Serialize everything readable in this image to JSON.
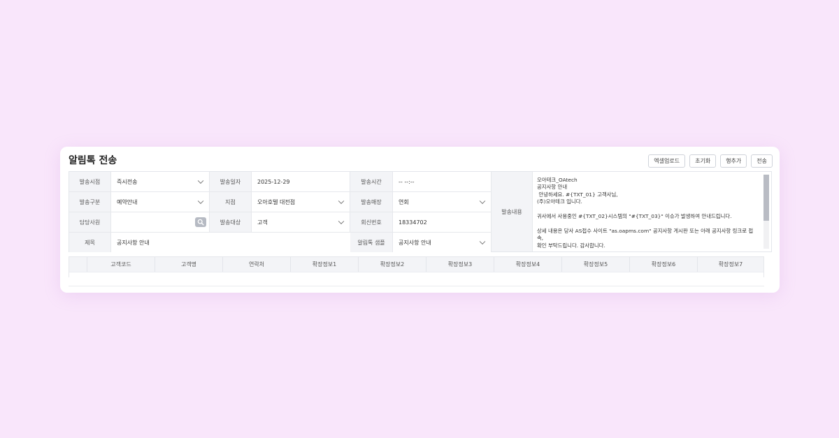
{
  "page": {
    "title": "알림톡 전송"
  },
  "toolbar": {
    "excel_upload": "엑셀업로드",
    "reset": "초기화",
    "add_row": "행추가",
    "send": "전송"
  },
  "form": {
    "send_timing": {
      "label": "발송시점",
      "value": "즉시전송"
    },
    "send_date": {
      "label": "발송일자",
      "value": "2025-12-29"
    },
    "send_time": {
      "label": "발송시간",
      "value": "-- --:--"
    },
    "send_type": {
      "label": "발송구분",
      "value": "예약안내"
    },
    "branch": {
      "label": "지점",
      "value": "오아호텔 대전점"
    },
    "store": {
      "label": "발송매장",
      "value": "연회"
    },
    "staff": {
      "label": "담당사원",
      "value": ""
    },
    "target": {
      "label": "발송대상",
      "value": "고객"
    },
    "reply_number": {
      "label": "회신번호",
      "value": "18334702"
    },
    "subject": {
      "label": "제목",
      "value": "공지사항 안내"
    },
    "sample": {
      "label": "알림톡 샘플",
      "value": "공지사항 안내"
    },
    "content": {
      "label": "발송내용",
      "text": "오아테크_OAtech\n공지사항 안내\n 안녕하세요. #{TXT_01} 고객사님,\n(주)오아테크 입니다.\n\n귀사에서 사용중인 #{TXT_02}시스템의 \"#{TXT_03}\" 이슈가 발생하여 안내드립니다.\n\n상세 내용은 당사 AS접수 사이트 \"as.oapms.com\" 공지사항 게시판 또는 아래 공지사항 링크로 접속,\n확인 부탁드립니다. 감사합니다."
    }
  },
  "grid": {
    "columns": [
      "고객코드",
      "고객명",
      "연락처",
      "확장정보1",
      "확장정보2",
      "확장정보3",
      "확장정보4",
      "확장정보5",
      "확장정보6",
      "확장정보7"
    ]
  }
}
